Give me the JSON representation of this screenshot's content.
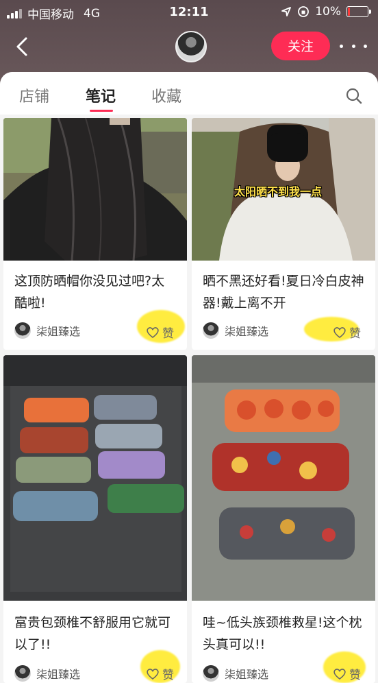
{
  "status": {
    "carrier": "中国移动",
    "network": "4G",
    "time": "12:11",
    "battery": "10%",
    "battery_level": 0.1
  },
  "header": {
    "follow_label": "关注"
  },
  "tabs": [
    {
      "label": "店铺"
    },
    {
      "label": "笔记"
    },
    {
      "label": "收藏"
    }
  ],
  "notes": [
    {
      "title": "这顶防晒帽你没见过吧?太酷啦!",
      "author": "柒姐臻选",
      "like_label": "赞",
      "image_overlay_text": ""
    },
    {
      "title": "晒不黑还好看!夏日冷白皮神器!戴上离不开",
      "author": "柒姐臻选",
      "like_label": "赞",
      "image_overlay_text": "太阳晒不到我一点"
    },
    {
      "title": "富贵包颈椎不舒服用它就可以了!!",
      "author": "柒姐臻选",
      "like_label": "赞",
      "image_overlay_text": ""
    },
    {
      "title": "哇~低头族颈椎救星!这个枕头真可以!!",
      "author": "柒姐臻选",
      "like_label": "赞",
      "image_overlay_text": ""
    }
  ],
  "colors": {
    "accent": "#fe2c55",
    "header_bg": "#5a4a4e"
  }
}
